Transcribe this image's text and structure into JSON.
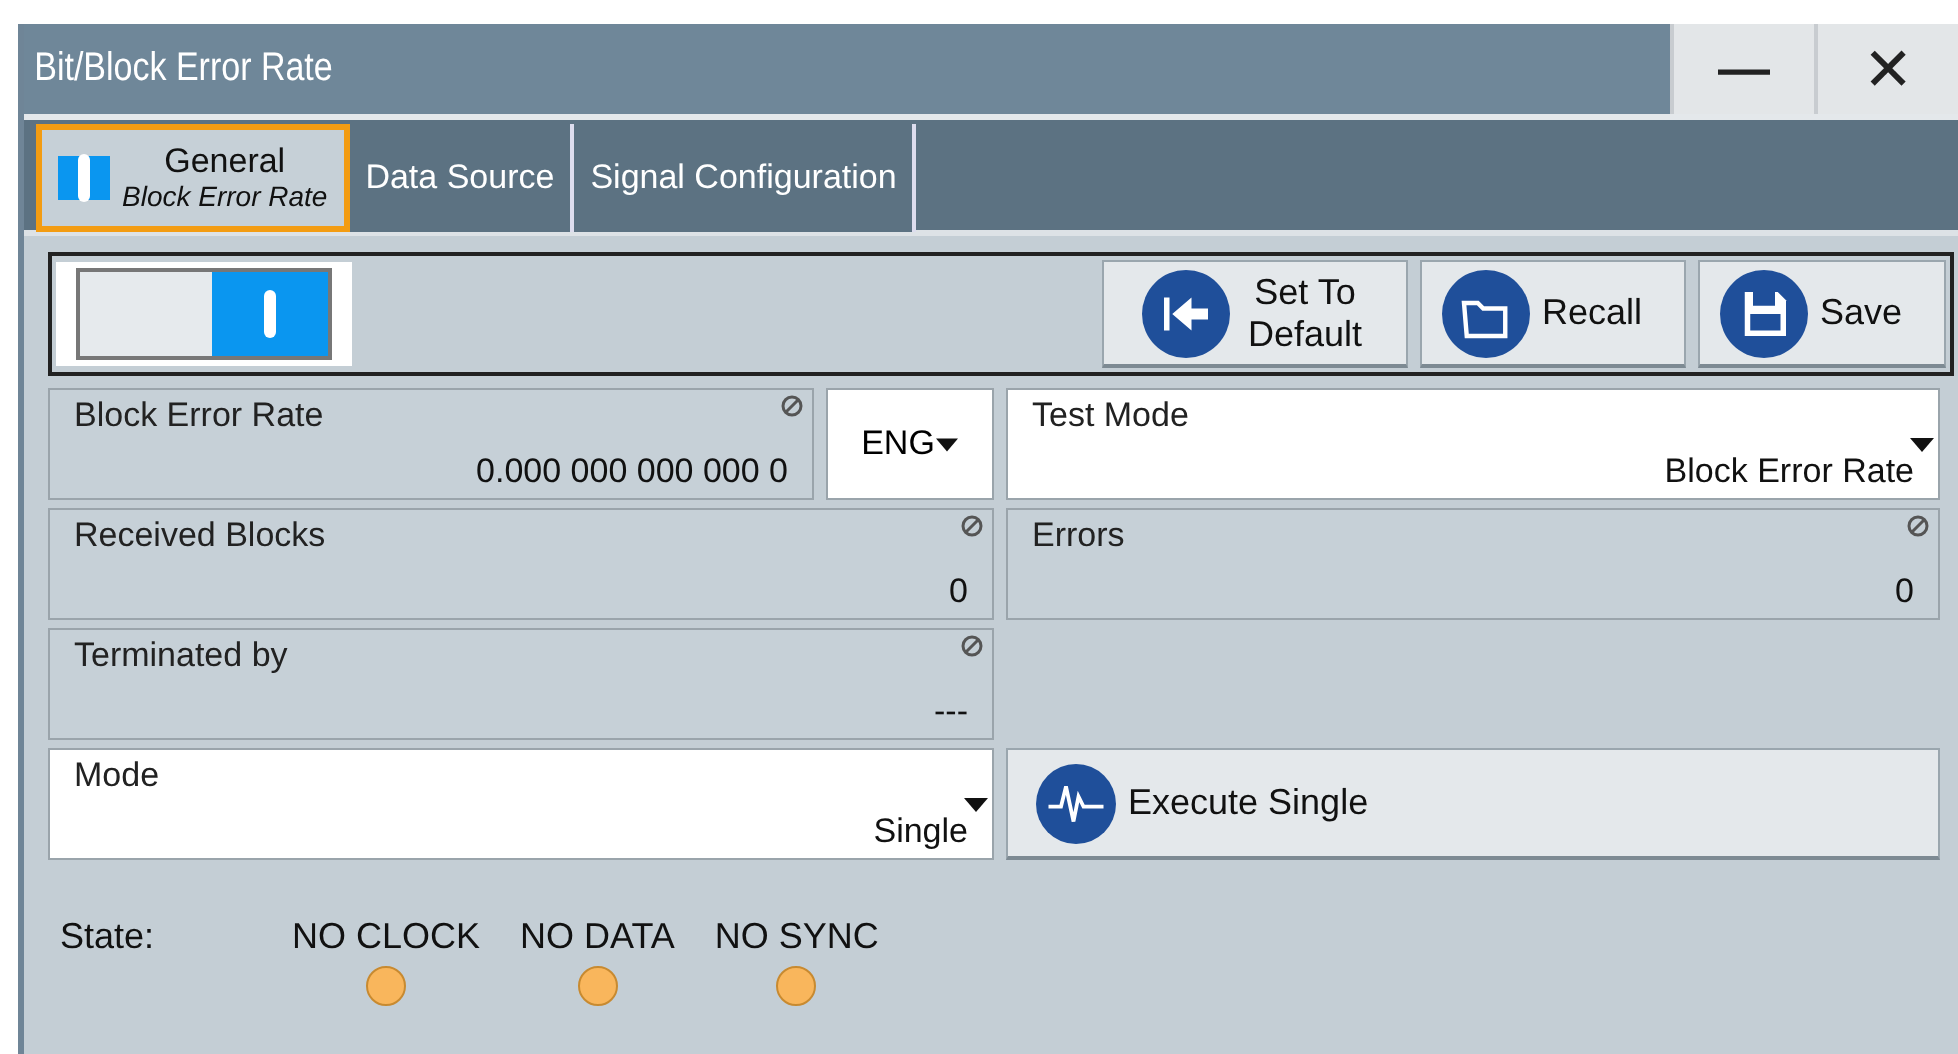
{
  "window": {
    "title": "Bit/Block Error Rate",
    "minimize_label": "—",
    "close_label": "✕"
  },
  "tabs": [
    {
      "label": "General",
      "sublabel": "Block Error Rate",
      "selected": true,
      "on": true
    },
    {
      "label": "Data Source",
      "selected": false
    },
    {
      "label": "Signal Configuration",
      "selected": false
    }
  ],
  "state_toggle": {
    "on": true
  },
  "buttons": [
    {
      "kind": "default",
      "label": "Set To Default"
    },
    {
      "kind": "recall",
      "label": "Recall"
    },
    {
      "kind": "save",
      "label": "Save"
    }
  ],
  "fields": {
    "block_error_rate": {
      "label": "Block Error Rate",
      "value": "0.000 000 000 000 0",
      "unit": "ENG"
    },
    "test_mode": {
      "label": "Test Mode",
      "value": "Block Error Rate"
    },
    "received_blocks": {
      "label": "Received Blocks",
      "value": "0"
    },
    "errors": {
      "label": "Errors",
      "value": "0"
    },
    "terminated_by": {
      "label": "Terminated by",
      "value": "---"
    },
    "mode": {
      "label": "Mode",
      "value": "Single"
    }
  },
  "execute_button": {
    "label": "Execute Single"
  },
  "state": {
    "label": "State:",
    "indicators": [
      {
        "label": "NO CLOCK"
      },
      {
        "label": "NO DATA"
      },
      {
        "label": "NO SYNC"
      }
    ]
  }
}
